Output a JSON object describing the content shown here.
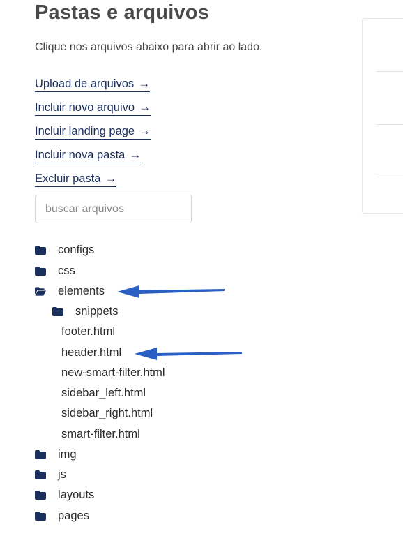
{
  "header": {
    "title": "Pastas e arquivos",
    "subtitle": "Clique nos arquivos abaixo para abrir ao lado."
  },
  "actions": [
    {
      "label": "Upload de arquivos",
      "icon": "arrow-right-icon"
    },
    {
      "label": "Incluir novo arquivo",
      "icon": "arrow-right-icon"
    },
    {
      "label": "Incluir landing page",
      "icon": "arrow-right-icon"
    },
    {
      "label": "Incluir nova pasta",
      "icon": "arrow-right-icon"
    },
    {
      "label": "Excluir pasta",
      "icon": "arrow-right-icon"
    }
  ],
  "search": {
    "placeholder": "buscar arquivos",
    "value": ""
  },
  "tree": {
    "folders_top": [
      "configs",
      "css"
    ],
    "open_folder": "elements",
    "subfolder": "snippets",
    "files": [
      "footer.html",
      "header.html",
      "new-smart-filter.html",
      "sidebar_left.html",
      "sidebar_right.html",
      "smart-filter.html"
    ],
    "folders_bottom": [
      "img",
      "js",
      "layouts",
      "pages"
    ]
  },
  "colors": {
    "link": "#1b2f5c",
    "folder_icon": "#1b2f5c",
    "annotation_arrow": "#2a5fc4"
  }
}
